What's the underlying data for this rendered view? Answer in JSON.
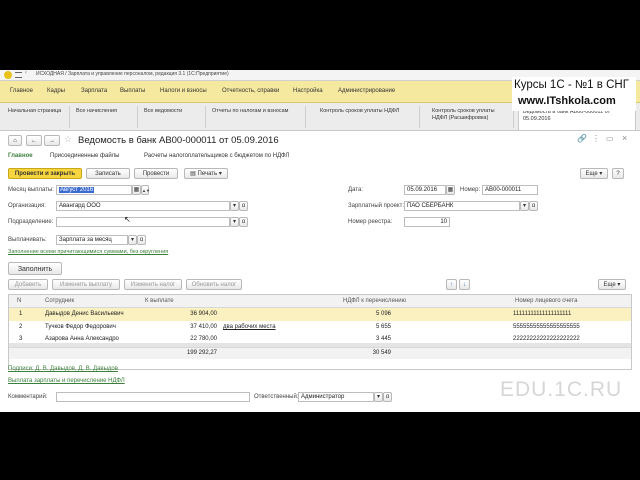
{
  "window": {
    "title": "ИСХОДНАЯ / Зарплата и управление персоналом, редакция 3.1 (1С:Предприятие)"
  },
  "menu": [
    "Главное",
    "Кадры",
    "Зарплата",
    "Выплаты",
    "Налоги и взносы",
    "Отчетность, справки",
    "Настройка",
    "Администрирование"
  ],
  "tabs": [
    {
      "label": "Начальная страница"
    },
    {
      "label": "Все начисления"
    },
    {
      "label": "Все ведомости"
    },
    {
      "label": "Отчеты по налогам и взносам"
    },
    {
      "label": "Контроль сроков уплаты НДФЛ"
    },
    {
      "label": "Контроль сроков уплаты НДФЛ (Расшифровка)"
    },
    {
      "label": "Ведомость в банк АВ00-000011 от 05.09.2016"
    }
  ],
  "form": {
    "title": "Ведомость в банк АВ00-000011 от 05.09.2016",
    "subtabs": [
      "Главное",
      "Присоединенные файлы",
      "Расчеты налогоплательщиков с бюджетом по НДФЛ"
    ],
    "buttons": {
      "post_close": "Провести и закрыть",
      "save": "Записать",
      "post": "Провести",
      "print": "Печать",
      "more": "Еще"
    },
    "fields": {
      "month_label": "Месяц выплаты:",
      "month_value": "Август 2016",
      "org_label": "Организация:",
      "org_value": "Авангард ООО",
      "dept_label": "Подразделение:",
      "dept_value": "",
      "pay_label": "Выплачивать:",
      "pay_value": "Зарплата за месяц",
      "date_label": "Дата:",
      "date_value": "05.09.2016",
      "num_label": "Номер:",
      "num_value": "АВ00-000011",
      "project_label": "Зарплатный проект:",
      "project_value": "ПАО СБЕРБАНК",
      "registry_label": "Номер реестра:",
      "registry_value": "10"
    },
    "fill_hint": "Заполнение всеми причитающимися суммами, без округления",
    "fill_button": "Заполнить",
    "table_buttons": {
      "add": "Добавить",
      "change_pay": "Изменить выплату",
      "change_tax": "Изменить налог",
      "refresh_tax": "Обновить налог",
      "more": "Еще"
    },
    "table": {
      "headers": [
        "N",
        "Сотрудник",
        "К выплате",
        "НДФЛ к перечислению",
        "Номер лицевого счета"
      ],
      "rows": [
        {
          "n": "1",
          "employee": "Давыдов Денис Васильевич",
          "amount": "36 904,00",
          "note": "",
          "ndfl": "5 096",
          "account": "11111111111111111111"
        },
        {
          "n": "2",
          "employee": "Тучков Федор Федорович",
          "amount": "37 410,00",
          "note": "два рабочих места",
          "ndfl": "5 655",
          "account": "55555555555555555555"
        },
        {
          "n": "3",
          "employee": "Азарова Анна Александро",
          "amount": "22 780,00",
          "note": "",
          "ndfl": "3 445",
          "account": "22222222222222222222"
        }
      ],
      "total_amount": "199 292,27",
      "total_ndfl": "30 549"
    },
    "signatures": "Подписи: Д. В. Давыдов, Д. В. Давыдов",
    "payout_link": "Выплата зарплаты и перечисление НДФЛ",
    "comment_label": "Комментарий:",
    "responsible_label": "Ответственный:",
    "responsible_value": "Администратор"
  },
  "overlay": {
    "course": "Курсы 1С - №1 в СНГ",
    "site": "www.ITshkola.com",
    "watermark": "EDU.1C.RU"
  }
}
